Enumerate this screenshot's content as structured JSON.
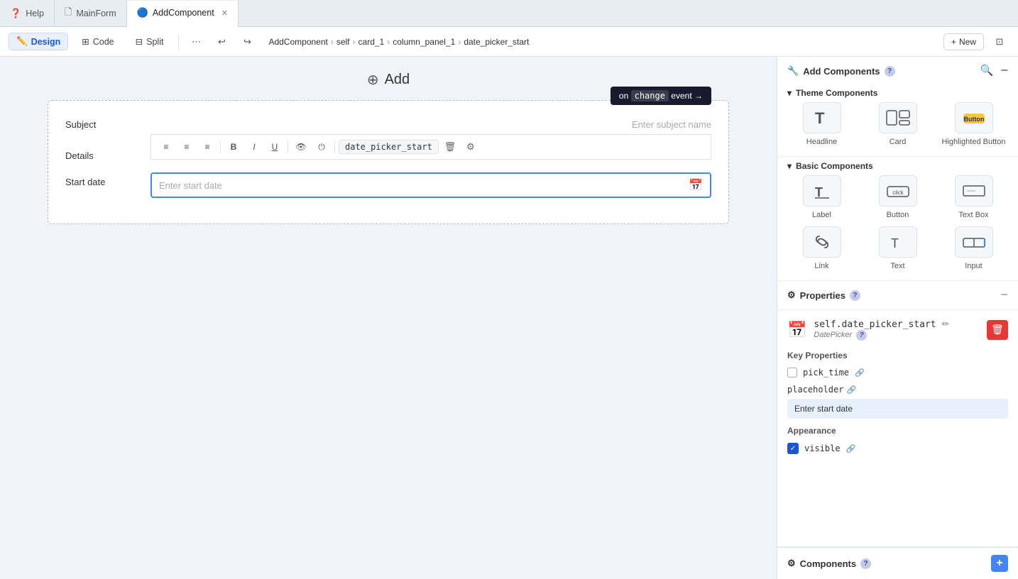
{
  "tabs": [
    {
      "id": "help",
      "icon": "❓",
      "label": "Help",
      "active": false,
      "closable": false
    },
    {
      "id": "mainform",
      "icon": "🗋",
      "label": "MainForm",
      "active": false,
      "closable": false
    },
    {
      "id": "addcomponent",
      "icon": "🔵",
      "label": "AddComponent",
      "active": true,
      "closable": true
    }
  ],
  "toolbar": {
    "design_label": "Design",
    "code_label": "Code",
    "split_label": "Split",
    "new_label": "+ New"
  },
  "breadcrumb": {
    "parts": [
      "AddComponent",
      "self",
      "card_1",
      "column_panel_1",
      "date_picker_start"
    ]
  },
  "canvas": {
    "add_label": "Add",
    "form": {
      "subject_label": "Subject",
      "subject_placeholder": "Enter subject name",
      "details_label": "Details",
      "start_date_label": "Start date",
      "start_date_placeholder": "Enter start date",
      "event_tooltip": "on change event →",
      "date_picker_name": "date_picker_start"
    }
  },
  "right_panel": {
    "add_components_label": "Add Components",
    "theme_components_label": "Theme Components",
    "basic_components_label": "Basic Components",
    "theme_items": [
      {
        "id": "headline",
        "label": "Headline",
        "icon": "T̲"
      },
      {
        "id": "card",
        "label": "Card",
        "icon": "⊞"
      },
      {
        "id": "highlighted-button",
        "label": "Highlighted Button",
        "icon": "☎"
      }
    ],
    "basic_items": [
      {
        "id": "label",
        "label": "Label",
        "icon": "T̲"
      },
      {
        "id": "button",
        "label": "Button",
        "icon": "☎"
      },
      {
        "id": "text-box",
        "label": "Text Box",
        "icon": "▭"
      }
    ],
    "basic_items_row2": [
      {
        "id": "link",
        "label": "Link",
        "icon": "🔗"
      },
      {
        "id": "text",
        "label": "Text",
        "icon": "T"
      },
      {
        "id": "input",
        "label": "Input",
        "icon": "▭"
      }
    ],
    "properties": {
      "section_label": "Properties",
      "component_name": "self.date_picker_start",
      "component_type": "DatePicker",
      "key_props_label": "Key Properties",
      "pick_time_label": "pick_time",
      "pick_time_checked": false,
      "placeholder_label": "placeholder",
      "placeholder_value": "Enter start date",
      "appearance_label": "Appearance",
      "visible_label": "visible",
      "visible_checked": true
    },
    "components_bottom_label": "Components"
  }
}
